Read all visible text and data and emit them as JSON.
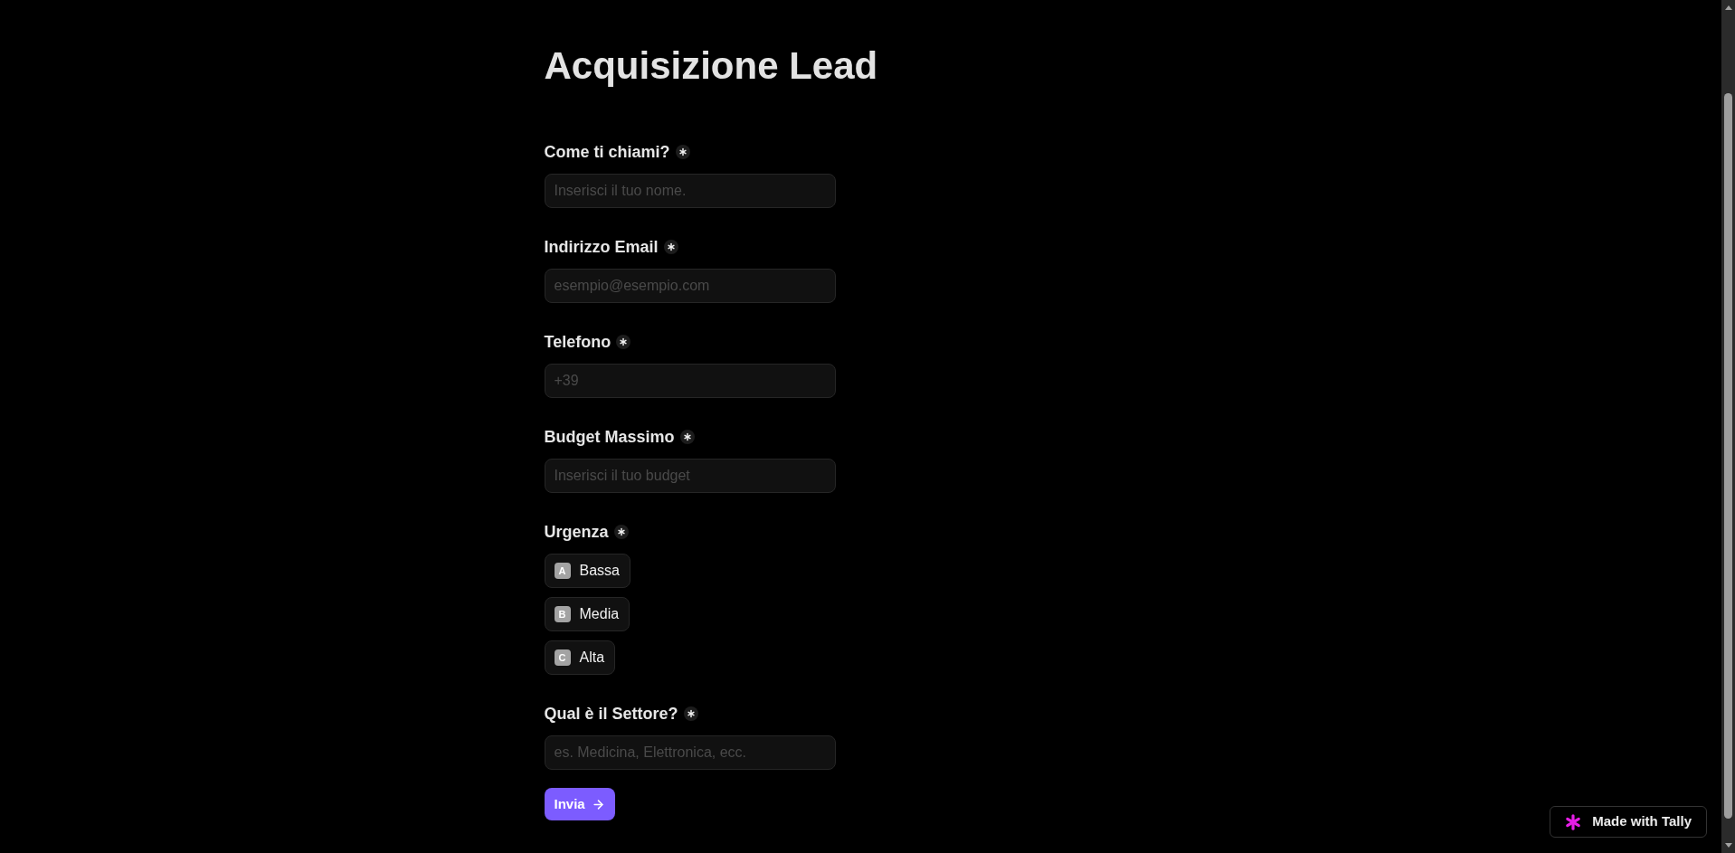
{
  "title": "Acquisizione Lead",
  "fields": [
    {
      "kind": "text",
      "label": "Come ti chiami?",
      "required": true,
      "placeholder": "Inserisci il tuo nome."
    },
    {
      "kind": "text",
      "label": "Indirizzo Email",
      "required": true,
      "placeholder": "esempio@esempio.com"
    },
    {
      "kind": "text",
      "label": "Telefono",
      "required": true,
      "placeholder": "+39"
    },
    {
      "kind": "text",
      "label": "Budget Massimo",
      "required": true,
      "placeholder": "Inserisci il tuo budget"
    },
    {
      "kind": "choice",
      "label": "Urgenza",
      "required": true,
      "options": [
        {
          "key": "A",
          "label": "Bassa",
          "selected": false
        },
        {
          "key": "B",
          "label": "Media",
          "selected": false
        },
        {
          "key": "C",
          "label": "Alta",
          "selected": false
        }
      ]
    },
    {
      "kind": "text",
      "label": "Qual è il Settore?",
      "required": true,
      "placeholder": "es. Medicina, Elettronica, ecc."
    }
  ],
  "submit": {
    "label": "Invia"
  },
  "badge": {
    "label": "Made with Tally"
  }
}
